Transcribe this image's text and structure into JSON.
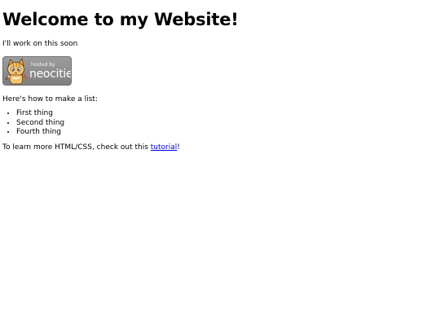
{
  "heading": "Welcome to my Website!",
  "intro": "I'll work on this soon",
  "badge": {
    "hosted_by": "hosted by",
    "brand": "neocities",
    "icon": "neocities-cat-icon"
  },
  "list_intro": "Here's how to make a list:",
  "list_items": [
    "First thing",
    "Second thing",
    "Fourth thing"
  ],
  "footer": {
    "prefix": "To learn more HTML/CSS, check out this ",
    "link_text": "tutorial",
    "suffix": "!"
  },
  "colors": {
    "link": "#0000ee",
    "badge_bg": "#8c8c8c"
  }
}
